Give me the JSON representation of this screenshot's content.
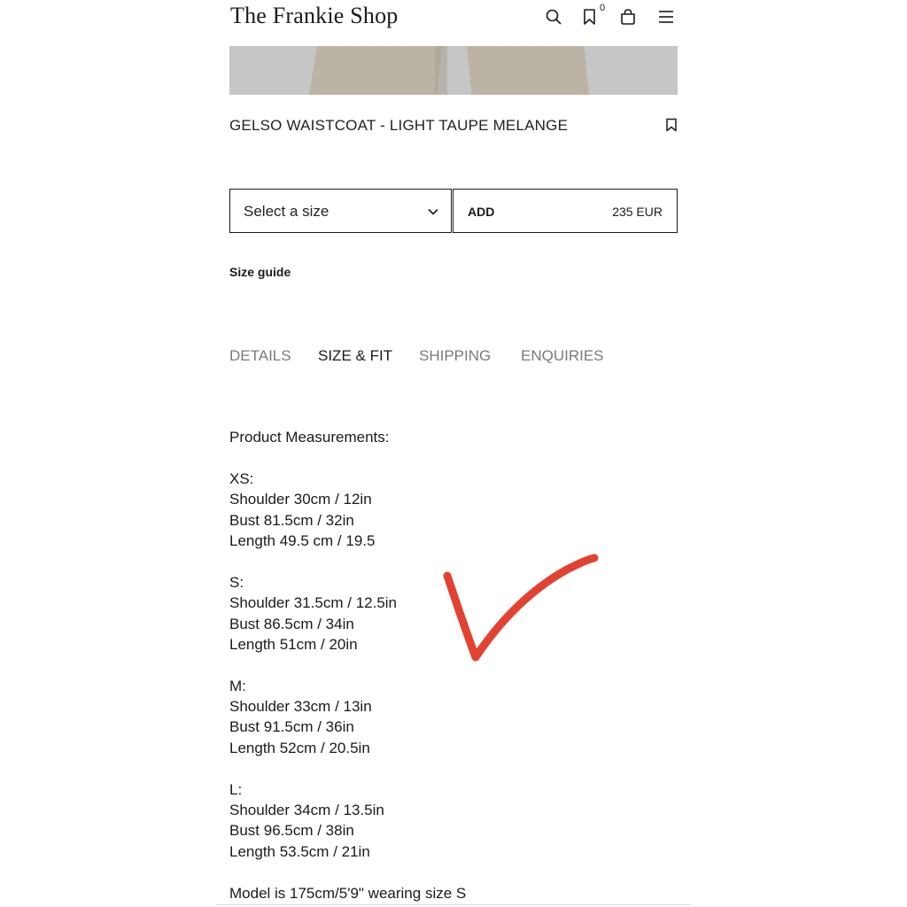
{
  "header": {
    "logo": "The Frankie Shop",
    "wishlist_count": "0",
    "icons": [
      "search-icon",
      "bookmark-icon",
      "bag-icon",
      "menu-icon"
    ]
  },
  "product": {
    "title": "GELSO WAISTCOAT - LIGHT TAUPE MELANGE",
    "size_select": {
      "value": "Select a size"
    },
    "add_label": "ADD",
    "price": "235 EUR",
    "size_guide": "Size guide"
  },
  "tabs": [
    {
      "label": "DETAILS",
      "active": false
    },
    {
      "label": "SIZE & FIT",
      "active": true
    },
    {
      "label": "SHIPPING",
      "active": false
    },
    {
      "label": "ENQUIRIES",
      "active": false
    }
  ],
  "size_fit": {
    "heading": "Product Measurements:",
    "sizes": [
      {
        "name": "XS:",
        "lines": [
          "Shoulder 30cm / 12in",
          "Bust 81.5cm / 32in",
          "Length 49.5 cm / 19.5"
        ]
      },
      {
        "name": "S:",
        "lines": [
          "Shoulder 31.5cm / 12.5in",
          "Bust 86.5cm / 34in",
          "Length 51cm / 20in"
        ]
      },
      {
        "name": "M:",
        "lines": [
          "Shoulder 33cm / 13in",
          "Bust 91.5cm / 36in",
          "Length 52cm / 20.5in"
        ]
      },
      {
        "name": "L:",
        "lines": [
          "Shoulder 34cm / 13.5in",
          "Bust 96.5cm / 38in",
          "Length 53.5cm / 21in"
        ]
      }
    ],
    "model_note": "Model is 175cm/5'9\" wearing size S"
  },
  "colors": {
    "text": "#1a1a1a",
    "inactive_tab": "#7a7a7a",
    "check_mark": "#e0321f"
  }
}
